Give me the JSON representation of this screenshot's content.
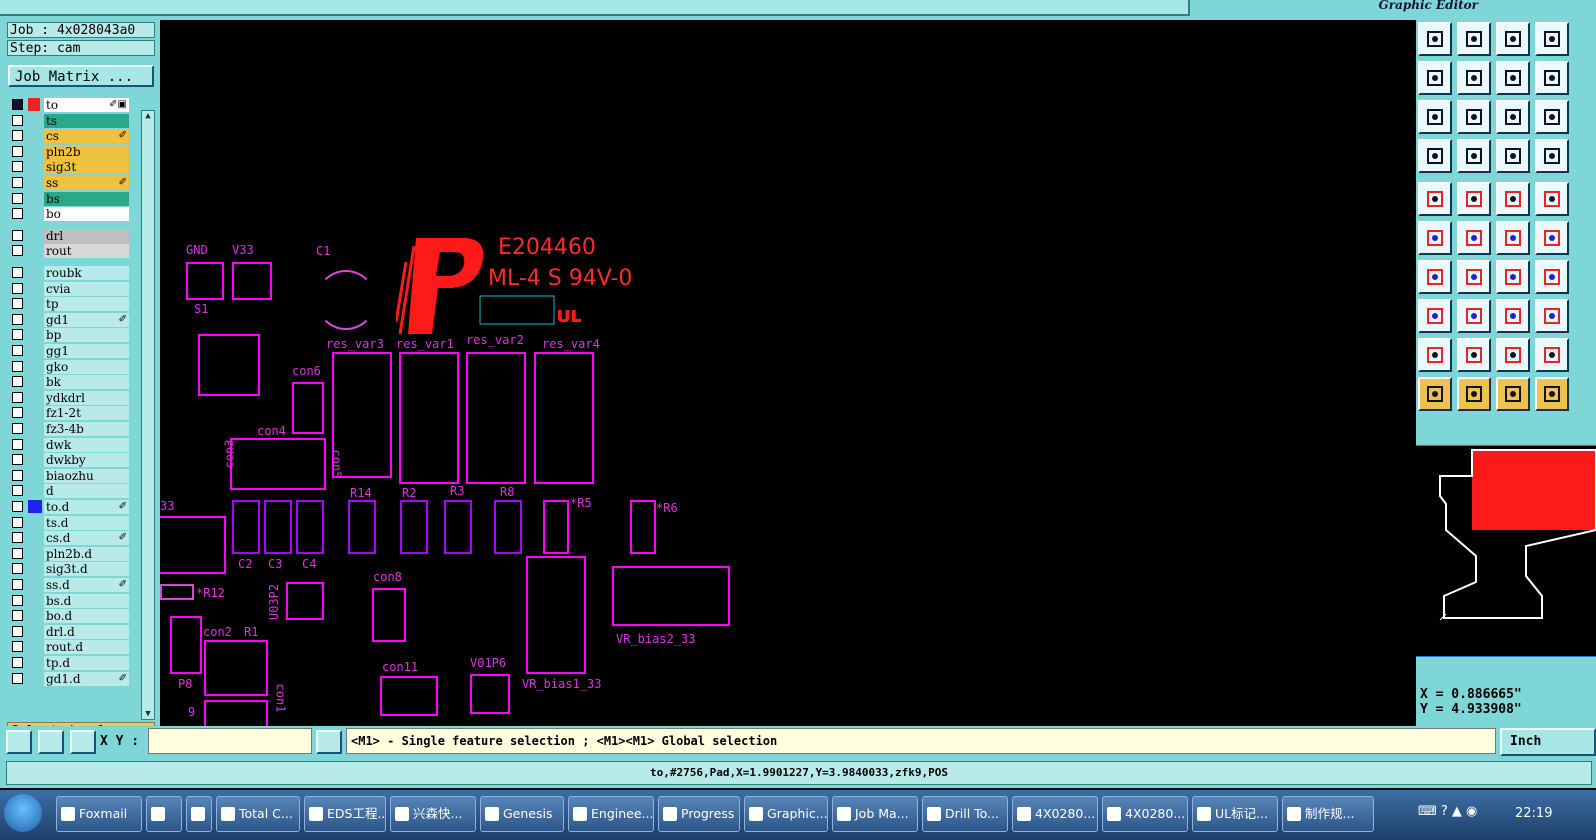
{
  "header": {
    "brand_subtitle": "Graphic Editor"
  },
  "job": {
    "job_label": "Job : 4x028043a0",
    "step_label": "Step: cam",
    "job_matrix_button": "Job Matrix ..."
  },
  "layers": [
    {
      "name": "to",
      "color": "#ffffff",
      "mark": "✐▣",
      "active": true
    },
    {
      "name": "ts",
      "color": "#2aa88a",
      "mark": ""
    },
    {
      "name": "cs",
      "color": "#f0c040",
      "mark": "✐"
    },
    {
      "name": "pln2b",
      "color": "#f0c040",
      "mark": ""
    },
    {
      "name": "sig3t",
      "color": "#f0c040",
      "mark": ""
    },
    {
      "name": "ss",
      "color": "#f0c040",
      "mark": "✐"
    },
    {
      "name": "bs",
      "color": "#2aa88a",
      "mark": ""
    },
    {
      "name": "bo",
      "color": "#ffffff",
      "mark": ""
    },
    {
      "name": "drl",
      "color": "#c0c0c0",
      "mark": ""
    },
    {
      "name": "rout",
      "color": "#d8d8d8",
      "mark": ""
    },
    {
      "name": "roubk",
      "color": "#b8eaea",
      "mark": ""
    },
    {
      "name": "cvia",
      "color": "#b8eaea",
      "mark": ""
    },
    {
      "name": "tp",
      "color": "#b8eaea",
      "mark": ""
    },
    {
      "name": "gd1",
      "color": "#b8eaea",
      "mark": "✐"
    },
    {
      "name": "bp",
      "color": "#b8eaea",
      "mark": ""
    },
    {
      "name": "gg1",
      "color": "#b8eaea",
      "mark": ""
    },
    {
      "name": "gko",
      "color": "#b8eaea",
      "mark": ""
    },
    {
      "name": "bk",
      "color": "#b8eaea",
      "mark": ""
    },
    {
      "name": "ydkdrl",
      "color": "#b8eaea",
      "mark": ""
    },
    {
      "name": "fz1-2t",
      "color": "#b8eaea",
      "mark": ""
    },
    {
      "name": "fz3-4b",
      "color": "#b8eaea",
      "mark": ""
    },
    {
      "name": "dwk",
      "color": "#b8eaea",
      "mark": ""
    },
    {
      "name": "dwkby",
      "color": "#b8eaea",
      "mark": ""
    },
    {
      "name": "biaozhu",
      "color": "#b8eaea",
      "mark": ""
    },
    {
      "name": "d",
      "color": "#b8eaea",
      "mark": ""
    },
    {
      "name": "to.d",
      "color": "#b8eaea",
      "mark": "✐",
      "blue": true
    },
    {
      "name": "ts.d",
      "color": "#b8eaea",
      "mark": ""
    },
    {
      "name": "cs.d",
      "color": "#b8eaea",
      "mark": "✐"
    },
    {
      "name": "pln2b.d",
      "color": "#b8eaea",
      "mark": ""
    },
    {
      "name": "sig3t.d",
      "color": "#b8eaea",
      "mark": ""
    },
    {
      "name": "ss.d",
      "color": "#b8eaea",
      "mark": "✐"
    },
    {
      "name": "bs.d",
      "color": "#b8eaea",
      "mark": ""
    },
    {
      "name": "bo.d",
      "color": "#b8eaea",
      "mark": ""
    },
    {
      "name": "drl.d",
      "color": "#b8eaea",
      "mark": ""
    },
    {
      "name": "rout.d",
      "color": "#b8eaea",
      "mark": ""
    },
    {
      "name": "tp.d",
      "color": "#b8eaea",
      "mark": ""
    },
    {
      "name": "gd1.d",
      "color": "#b8eaea",
      "mark": "✐"
    }
  ],
  "selected_label": "Selected : 1",
  "canvas": {
    "logo_code": "E204460",
    "logo_material": "ML-4 S 94V-0",
    "labels": [
      "GND",
      "V33",
      "C1",
      "S1",
      "con6",
      "res_var3",
      "res_var1",
      "res_var2",
      "res_var4",
      "con4",
      "con3",
      "con5",
      "R14",
      "R2",
      "R3",
      "R8",
      "*R5",
      "*R6",
      "33",
      "C2",
      "C3",
      "C4",
      "*R12",
      "U03P2",
      "con8",
      "VR_bias2_33",
      "con2",
      "R1",
      "P8",
      "con11",
      "V01P6",
      "VR_bias1_33",
      "con1",
      "9"
    ]
  },
  "coords": {
    "x_label": "X = 0.886665\"",
    "y_label": "Y = 4.933908\""
  },
  "cmdbar": {
    "xy_label": "X Y :",
    "xy_value": "",
    "message": "<M1> - Single feature selection ; <M1><M1> Global selection",
    "units": "Inch"
  },
  "status": "to,#2756,Pad,X=1.9901227,Y=3.9840033,zfk9,POS",
  "taskbar": {
    "items": [
      "Foxmail",
      "",
      "",
      "Total C...",
      "EDS工程...",
      "兴森快...",
      "Genesis",
      "Enginee...",
      "Progress",
      "Graphic...",
      "Job Ma...",
      "Drill To...",
      "4X0280...",
      "4X0280...",
      "UL标记...",
      "制作规..."
    ],
    "clock": "22:19"
  },
  "colors": {
    "accent": "#7fd6d6",
    "trace": "#ff00ff",
    "logo": "#ff1a1a"
  }
}
